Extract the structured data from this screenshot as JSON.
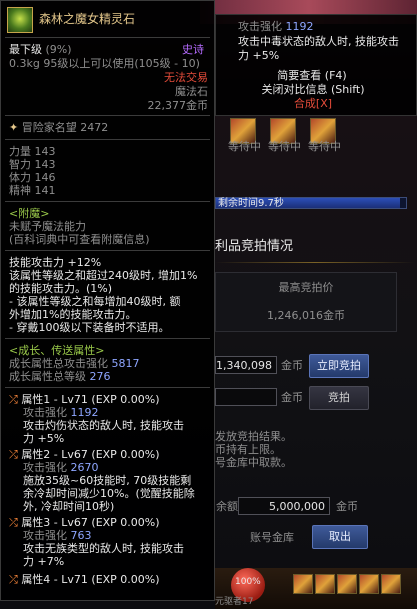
{
  "tooltip": {
    "item_name": "森林之魔女精灵石",
    "grade": "最下级",
    "grade_pct": "(9%)",
    "rarity": "史诗",
    "weight": "0.3kg",
    "level_req": "95级以上可以使用(105级 - 10)",
    "trade": "无法交易",
    "type": "魔法石",
    "price": "22,377金币",
    "adventurer_label": "冒险家名望",
    "adventurer_value": "2472",
    "stats": [
      {
        "name": "力量",
        "value": "143"
      },
      {
        "name": "智力",
        "value": "143"
      },
      {
        "name": "体力",
        "value": "146"
      },
      {
        "name": "精神",
        "value": "141"
      }
    ],
    "enchant_title": "<附魔>",
    "enchant_none": "未赋予魔法能力",
    "enchant_hint": "(百科词典中可查看附魔信息)",
    "effects": [
      "技能攻击力 +12%",
      "该属性等级之和超过240级时, 增加1%",
      "的技能攻击力。(1%)",
      "- 该属性等级之和每增加40级时, 额",
      "外增加1%的技能攻击力。",
      "- 穿戴100级以下装备时不适用。"
    ],
    "growth_title": "<成长、传送属性>",
    "growth_atk_label": "成长属性总攻击强化",
    "growth_atk_value": "5817",
    "growth_lv_label": "成长属性总等级",
    "growth_lv_value": "276",
    "attrs": [
      {
        "head": "属性1 - Lv71 (EXP 0.00%)",
        "sub_label": "攻击强化",
        "sub_value": "1192",
        "desc": [
          "攻击灼伤状态的敌人时, 技能攻击",
          "力 +5%"
        ]
      },
      {
        "head": "属性2 - Lv67 (EXP 0.00%)",
        "sub_label": "攻击强化",
        "sub_value": "2670",
        "desc": [
          "施放35级~60技能时, 70级技能剩",
          "余冷却时间减少10%。(觉醒技能除",
          "外, 冷却时间10秒)"
        ]
      },
      {
        "head": "属性3 - Lv67 (EXP 0.00%)",
        "sub_label": "攻击强化",
        "sub_value": "763",
        "desc": [
          "攻击无族类型的敌人时, 技能攻击",
          "力 +7%"
        ]
      },
      {
        "head": "属性4 - Lv71 (EXP 0.00%)"
      }
    ]
  },
  "right": {
    "atk_label": "攻击强化",
    "atk_value": "1192",
    "atk_desc_1": "攻击中毒状态的敌人时, 技能攻击",
    "atk_desc_2": "力 +5%",
    "brief_view": "简要查看 (F4)",
    "compare": "关闭对比信息 (Shift)",
    "synthesize": "合成[X]",
    "waiting": [
      "等待中",
      "等待中",
      "等待中"
    ],
    "remain_time": "剩余时间9.7秒",
    "auction_title": "利品竞拍情况",
    "highest_bid_label": "最高竞拍价",
    "highest_bid_value": "1,246,016金币",
    "buyout_amount": "1,340,098",
    "gold_unit": "金币",
    "buyout_button": "立即竞拍",
    "bid_button": "竞拍",
    "notice_1": "发放竞拍结果。",
    "notice_2": "币持有上限。",
    "notice_3": "号金库中取款。",
    "balance_label": "余额",
    "balance_value": "5,000,000",
    "account_vault": "账号金库",
    "cancel_button": "取出",
    "bottom_text": "元驱者17",
    "bottom_pct": "100%"
  }
}
